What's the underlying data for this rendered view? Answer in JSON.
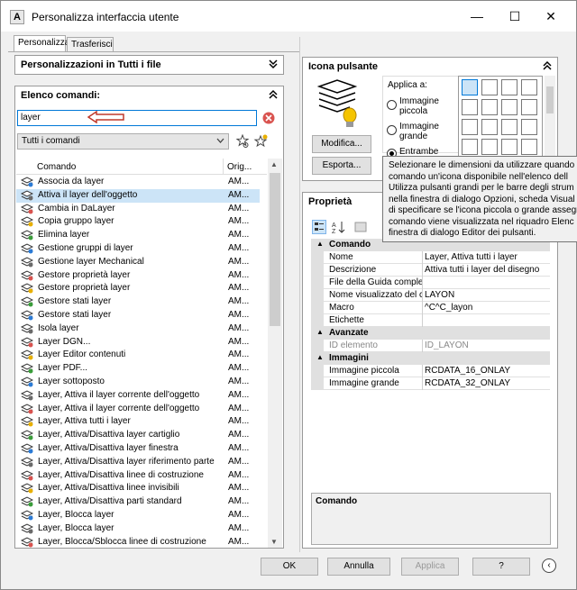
{
  "window": {
    "title": "Personalizza interfaccia utente",
    "app_icon_letter": "A",
    "minimize": "—",
    "maximize": "☐",
    "close": "✕"
  },
  "tabs": [
    {
      "label": "Personalizza"
    },
    {
      "label": "Trasferisci"
    }
  ],
  "customizations_panel": {
    "title": "Personalizzazioni in Tutti i file"
  },
  "commands_panel": {
    "title": "Elenco comandi:",
    "search_value": "layer",
    "filter_value": "Tutti i comandi",
    "col_command": "Comando",
    "col_origin": "Orig...",
    "rows": [
      {
        "name": "Associa da layer",
        "origin": "AM..."
      },
      {
        "name": "Attiva il layer dell'oggetto",
        "origin": "AM..."
      },
      {
        "name": "Cambia in DaLayer",
        "origin": "AM..."
      },
      {
        "name": "Copia gruppo layer",
        "origin": "AM..."
      },
      {
        "name": "Elimina layer",
        "origin": "AM..."
      },
      {
        "name": "Gestione gruppi di layer",
        "origin": "AM..."
      },
      {
        "name": "Gestione layer Mechanical",
        "origin": "AM..."
      },
      {
        "name": "Gestore proprietà layer",
        "origin": "AM..."
      },
      {
        "name": "Gestore proprietà layer",
        "origin": "AM..."
      },
      {
        "name": "Gestore stati layer",
        "origin": "AM..."
      },
      {
        "name": "Gestore stati layer",
        "origin": "AM..."
      },
      {
        "name": "Isola layer",
        "origin": "AM..."
      },
      {
        "name": "Layer DGN...",
        "origin": "AM..."
      },
      {
        "name": "Layer Editor contenuti",
        "origin": "AM..."
      },
      {
        "name": "Layer PDF...",
        "origin": "AM..."
      },
      {
        "name": "Layer sottoposto",
        "origin": "AM..."
      },
      {
        "name": "Layer, Attiva il layer corrente dell'oggetto",
        "origin": "AM..."
      },
      {
        "name": "Layer, Attiva il layer corrente dell'oggetto",
        "origin": "AM..."
      },
      {
        "name": "Layer, Attiva tutti i layer",
        "origin": "AM..."
      },
      {
        "name": "Layer, Attiva/Disattiva layer cartiglio",
        "origin": "AM..."
      },
      {
        "name": "Layer, Attiva/Disattiva layer finestra",
        "origin": "AM..."
      },
      {
        "name": "Layer, Attiva/Disattiva layer riferimento parte",
        "origin": "AM..."
      },
      {
        "name": "Layer, Attiva/Disattiva linee di costruzione",
        "origin": "AM..."
      },
      {
        "name": "Layer, Attiva/Disattiva linee invisibili",
        "origin": "AM..."
      },
      {
        "name": "Layer, Attiva/Disattiva parti standard",
        "origin": "AM..."
      },
      {
        "name": "Layer, Blocca layer",
        "origin": "AM..."
      },
      {
        "name": "Layer, Blocca layer",
        "origin": "AM..."
      },
      {
        "name": "Layer, Blocca/Sblocca linee di costruzione",
        "origin": "AM..."
      }
    ]
  },
  "icon_panel": {
    "title": "Icona pulsante",
    "apply_to": "Applica a:",
    "opt_small_1": "Immagine",
    "opt_small_2": "piccola",
    "opt_large_1": "Immagine",
    "opt_large_2": "grande",
    "opt_both": "Entrambe",
    "edit_button": "Modifica...",
    "export_button": "Esporta..."
  },
  "tooltip": {
    "lines": [
      "Selezionare le dimensioni da utilizzare quando",
      "comando un'icona disponibile nell'elenco dell",
      "Utilizza pulsanti grandi per le barre degli strum",
      "nella finestra di dialogo Opzioni, scheda Visual",
      "di specificare se l'icona piccola o grande assegn",
      "comando viene visualizzata nel riquadro Elenc",
      "finestra di dialogo Editor dei pulsanti."
    ]
  },
  "properties_panel": {
    "title": "Proprietà",
    "cat_command": "Comando",
    "cat_advanced": "Avanzate",
    "cat_images": "Immagini",
    "command_rows": [
      {
        "key": "Nome",
        "value": "Layer, Attiva tutti i layer"
      },
      {
        "key": "Descrizione",
        "value": "Attiva tutti i layer del disegno"
      },
      {
        "key": "File della Guida comple",
        "value": ""
      },
      {
        "key": "Nome visualizzato del c",
        "value": "LAYON"
      },
      {
        "key": "Macro",
        "value": "^C^C_layon"
      },
      {
        "key": "Etichette",
        "value": ""
      }
    ],
    "advanced_rows": [
      {
        "key": "ID elemento",
        "value": "ID_LAYON"
      }
    ],
    "image_rows": [
      {
        "key": "Immagine piccola",
        "value": "RCDATA_16_ONLAY"
      },
      {
        "key": "Immagine grande",
        "value": "RCDATA_32_ONLAY"
      }
    ],
    "description_title": "Comando"
  },
  "footer": {
    "ok": "OK",
    "cancel": "Annulla",
    "apply": "Applica",
    "help": "?"
  },
  "colors": {
    "selection": "#cce4f7",
    "accent_red": "#c0392b"
  }
}
